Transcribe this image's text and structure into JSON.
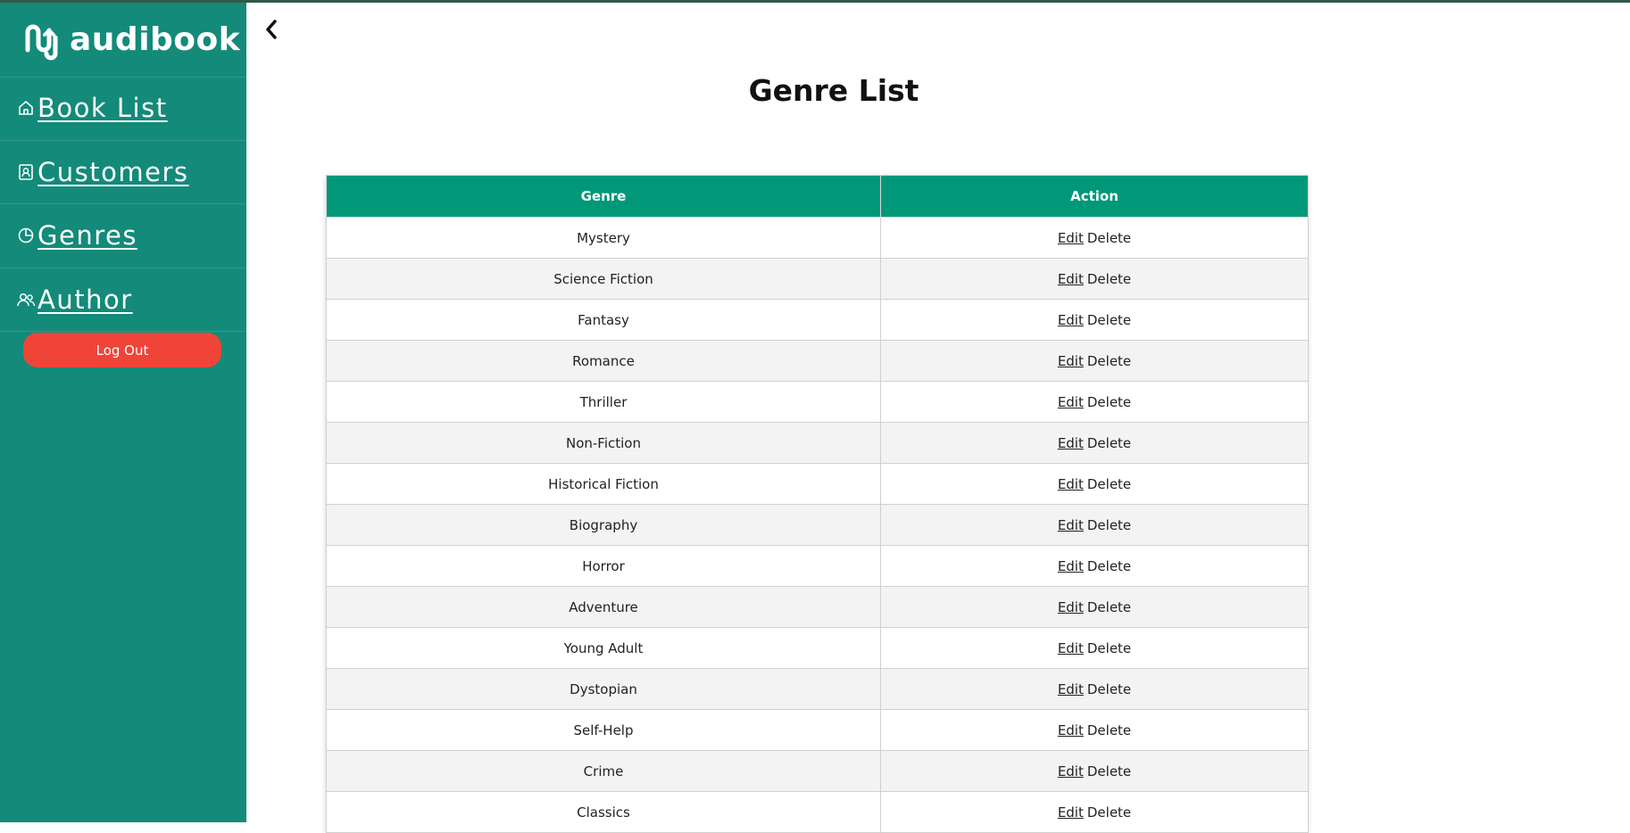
{
  "brand": {
    "name": "audibook"
  },
  "sidebar": {
    "items": [
      {
        "label": "Book List",
        "icon": "house-icon"
      },
      {
        "label": "Customers",
        "icon": "contact-card-icon"
      },
      {
        "label": "Genres",
        "icon": "pie-chart-icon"
      },
      {
        "label": "Author",
        "icon": "users-icon"
      }
    ],
    "logout_label": "Log Out"
  },
  "header": {
    "back_icon": "chevron-left-icon"
  },
  "page": {
    "title": "Genre List"
  },
  "table": {
    "headers": [
      "Genre",
      "Action"
    ],
    "edit_label": "Edit",
    "delete_label": "Delete",
    "rows": [
      "Mystery",
      "Science Fiction",
      "Fantasy",
      "Romance",
      "Thriller",
      "Non-Fiction",
      "Historical Fiction",
      "Biography",
      "Horror",
      "Adventure",
      "Young Adult",
      "Dystopian",
      "Self-Help",
      "Crime",
      "Classics"
    ]
  },
  "colors": {
    "sidebar_bg": "#138a7a",
    "table_header_bg": "#009879",
    "logout_bg": "#f04438",
    "row_alt_bg": "#f3f3f3"
  }
}
